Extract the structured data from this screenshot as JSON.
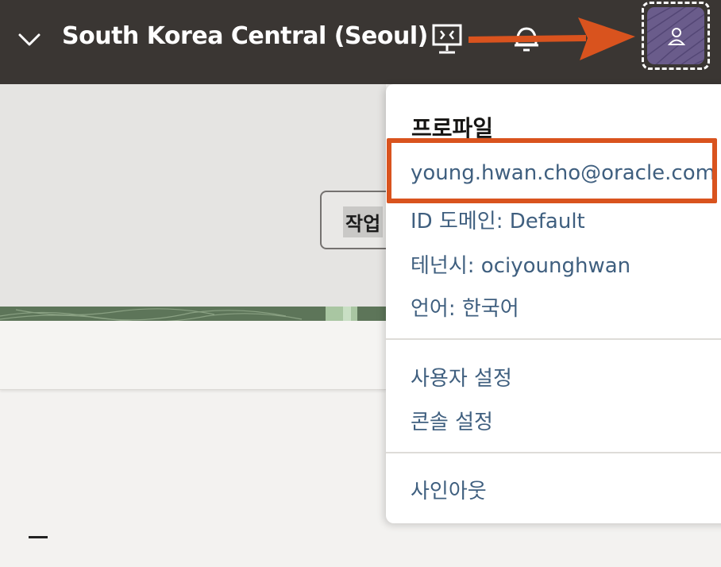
{
  "header": {
    "region_name": "South Korea Central (Seoul)",
    "icons": [
      "chevron-down-icon",
      "cloud-shell-icon",
      "bell-icon",
      "user-icon"
    ]
  },
  "action_button": {
    "label": "작업"
  },
  "profile_menu": {
    "heading": "프로파일",
    "email": "young.hwan.cho@oracle.com",
    "identity_domain": "ID 도메인: Default",
    "tenancy": "테넌시: ociyounghwan",
    "language": "언어: 한국어",
    "user_settings": "사용자 설정",
    "console_settings": "콘솔 설정",
    "sign_out": "사인아웃"
  },
  "colors": {
    "header_bg": "#3a3633",
    "link": "#3f5f7f",
    "annotation": "#d9531e",
    "avatar": "#6a5c8b"
  }
}
